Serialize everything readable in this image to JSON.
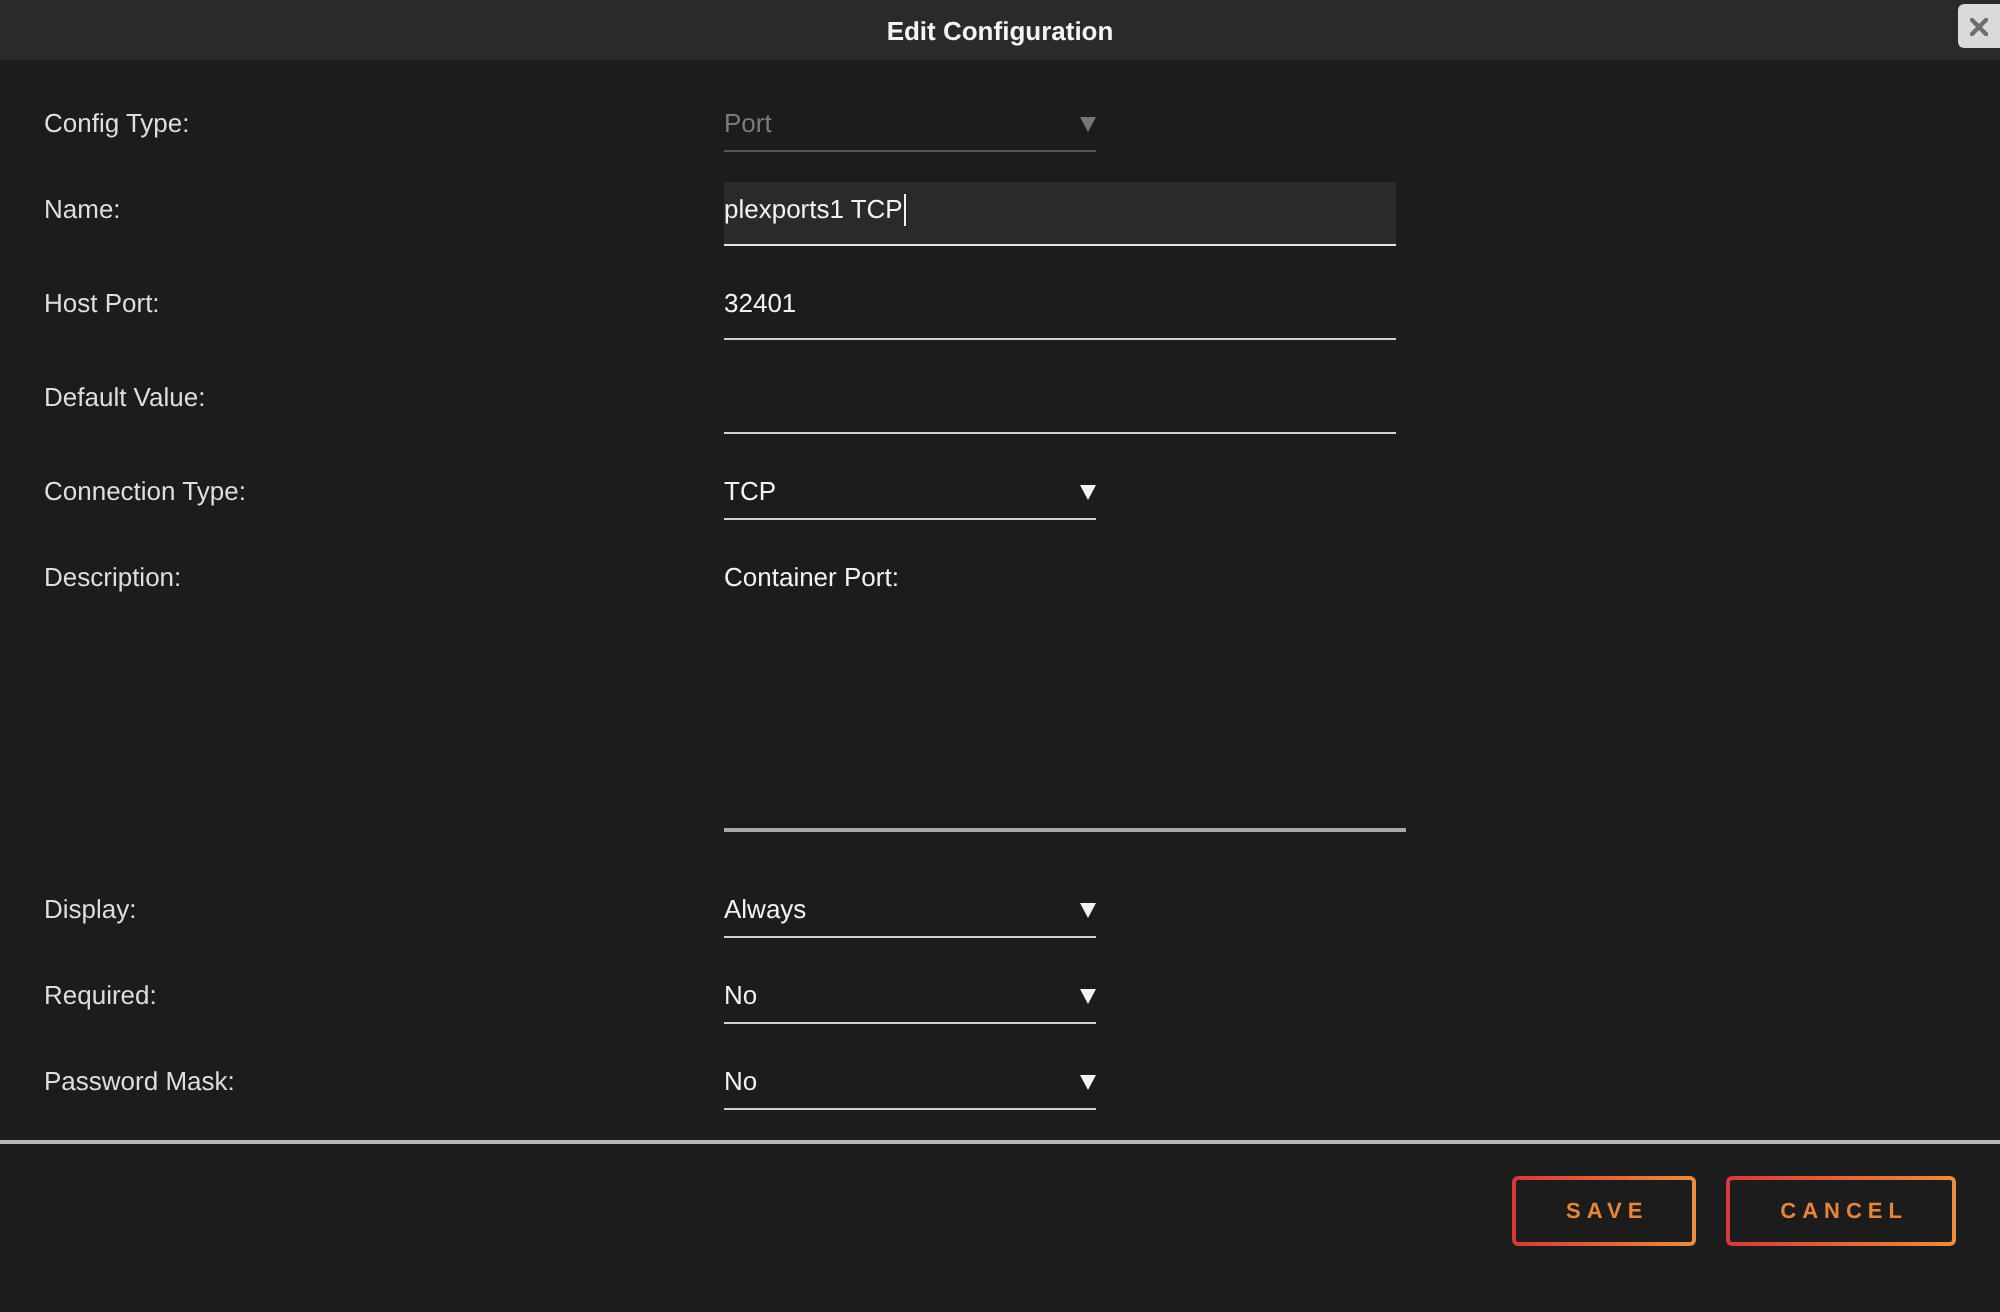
{
  "dialog": {
    "title": "Edit Configuration"
  },
  "fields": [
    {
      "label": "Config Type:",
      "kind": "select",
      "value": "Port",
      "disabled": true,
      "focused": false
    },
    {
      "label": "Name:",
      "kind": "input",
      "value": "plexports1 TCP",
      "disabled": false,
      "focused": true
    },
    {
      "label": "Host Port:",
      "kind": "input",
      "value": "32401",
      "disabled": false,
      "focused": false
    },
    {
      "label": "Default Value:",
      "kind": "input",
      "disabled": false,
      "focused": false
    },
    {
      "label": "Connection Type:",
      "kind": "select",
      "value": "TCP",
      "disabled": false,
      "focused": false
    },
    {
      "label": "Description:",
      "kind": "textarea",
      "value": "Container Port:",
      "disabled": false,
      "focused": false
    },
    {
      "label": "Display:",
      "kind": "select",
      "value": "Always",
      "disabled": false,
      "focused": false
    },
    {
      "label": "Required:",
      "kind": "select",
      "value": "No",
      "disabled": false,
      "focused": false
    },
    {
      "label": "Password Mask:",
      "kind": "select",
      "value": "No",
      "disabled": false,
      "focused": false
    }
  ],
  "buttons": [
    {
      "label": "SAVE"
    },
    {
      "label": "CANCEL"
    }
  ]
}
